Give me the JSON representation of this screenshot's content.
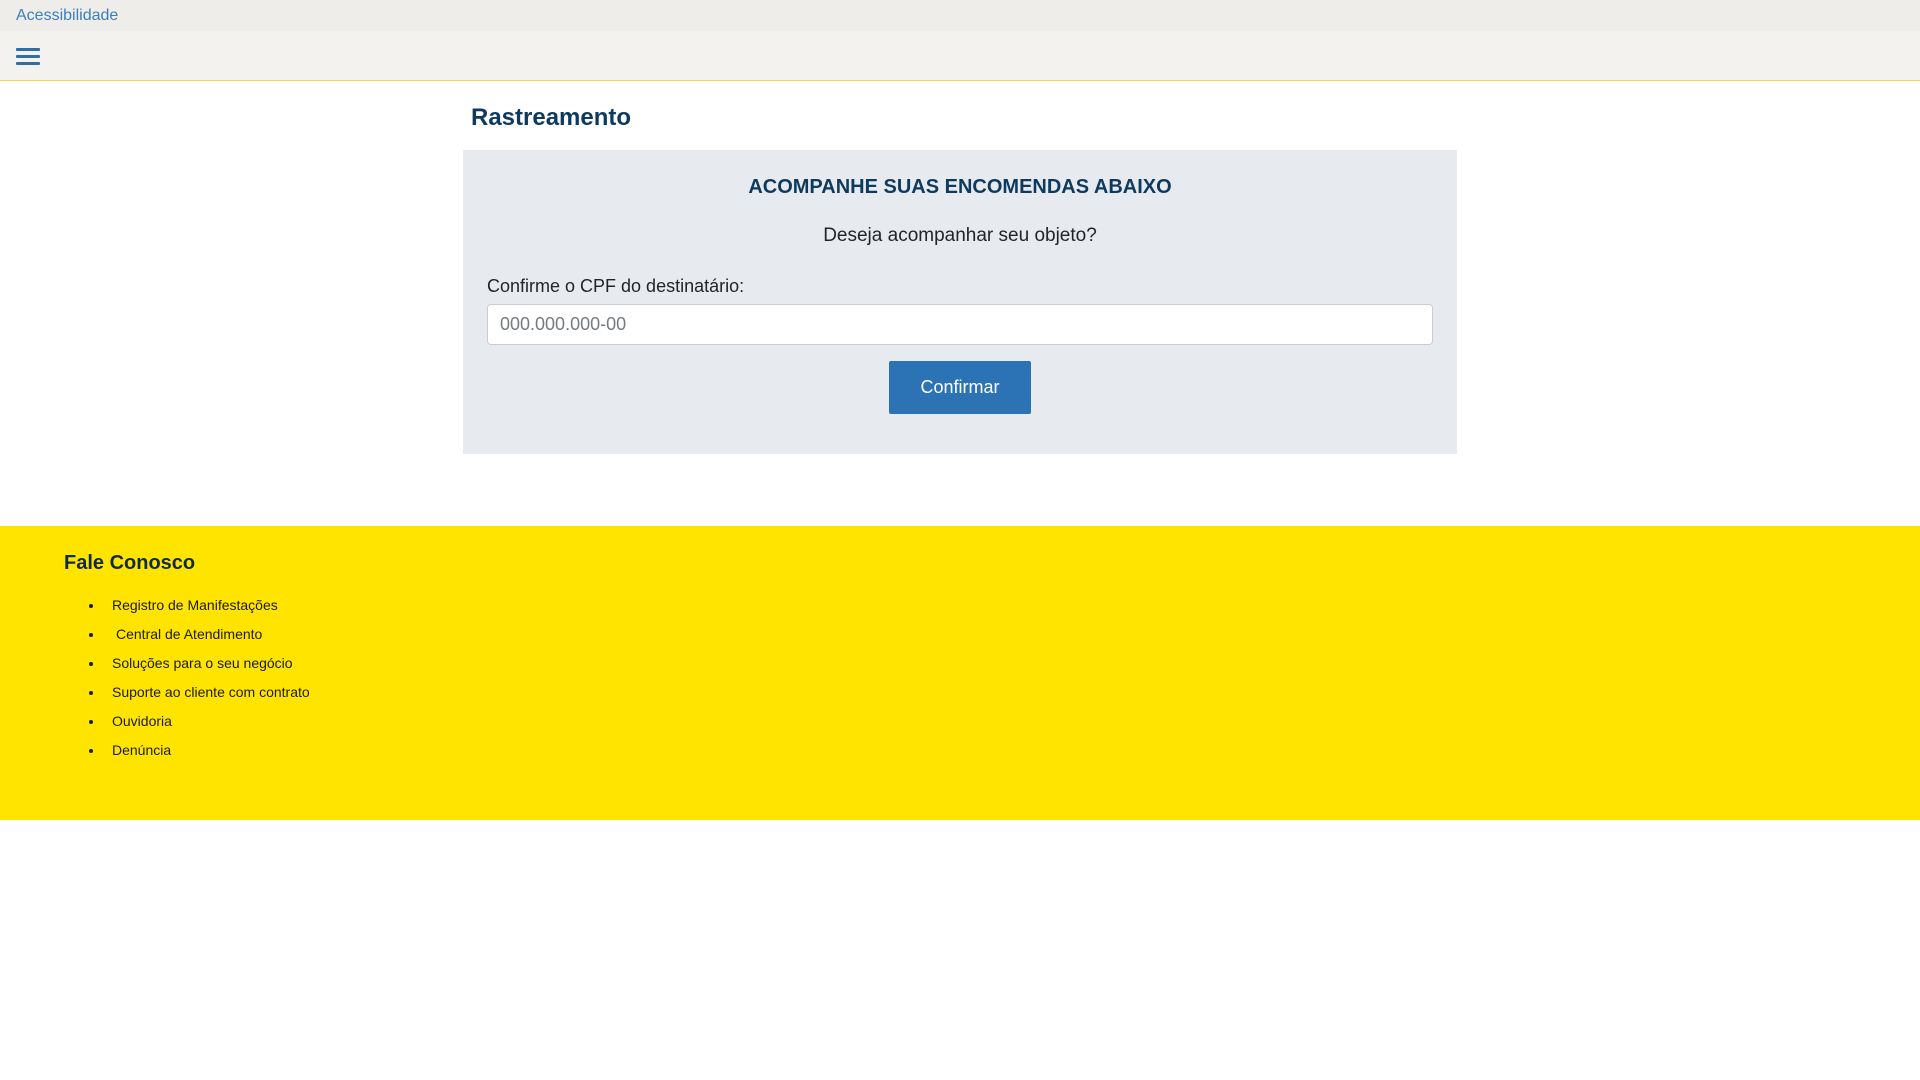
{
  "topbar": {
    "accessibility_label": "Acessibilidade"
  },
  "navbar": {
    "menu_icon": "hamburger-menu-icon"
  },
  "page": {
    "title": "Rastreamento"
  },
  "tracking_card": {
    "heading": "ACOMPANHE SUAS ENCOMENDAS ABAIXO",
    "question": "Deseja acompanhar seu objeto?",
    "cpf_label": "Confirme o CPF do destinatário:",
    "cpf_value": "",
    "cpf_placeholder": "000.000.000-00",
    "confirm_label": "Confirmar"
  },
  "footer": {
    "title": "Fale Conosco",
    "links": [
      "Registro de Manifestações",
      "Central de Atendimento",
      "Soluções para o seu negócio",
      "Suporte ao cliente com contrato",
      "Ouvidoria",
      "Denúncia"
    ]
  },
  "colors": {
    "brand_blue": "#0f3a5f",
    "button_blue": "#2c73b5",
    "footer_yellow": "#ffe400",
    "card_gray": "#e7ebef"
  }
}
